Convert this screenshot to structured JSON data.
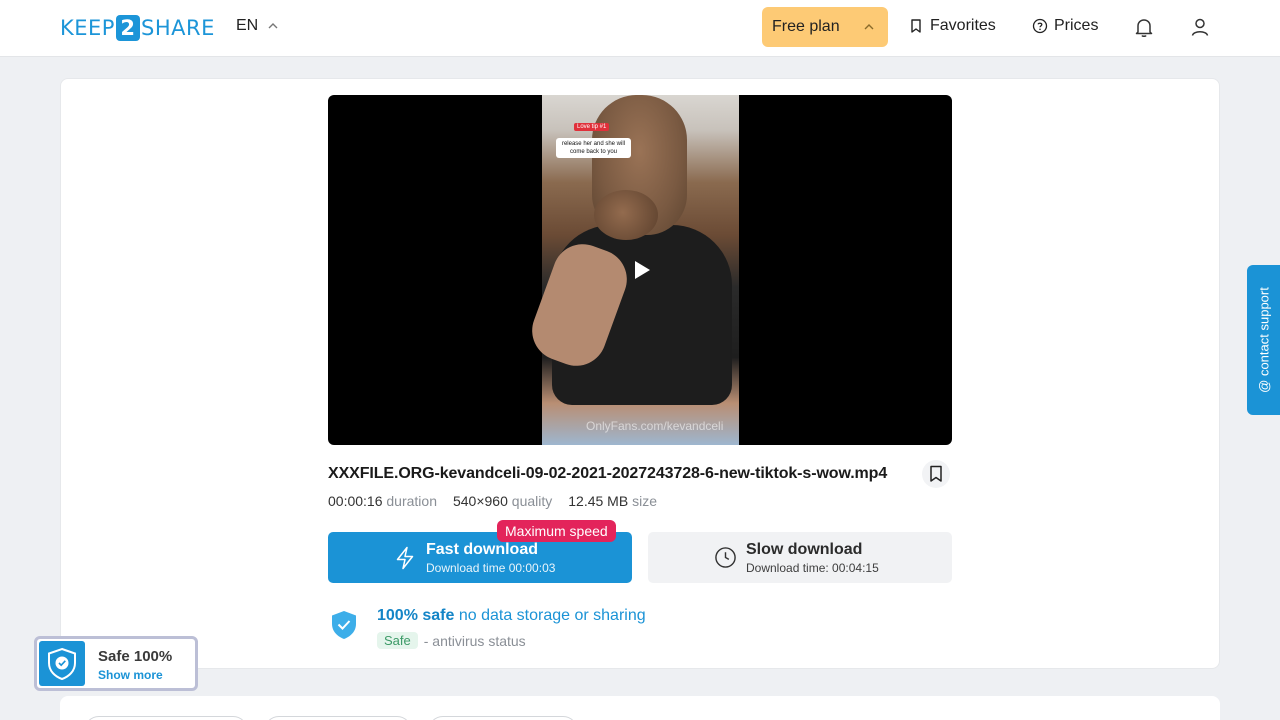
{
  "header": {
    "logo_left": "KEEP",
    "logo_num": "2",
    "logo_right": "SHARE",
    "lang": "EN",
    "plan_label": "Free plan",
    "favorites": "Favorites",
    "prices": "Prices"
  },
  "video": {
    "caption_red": "Love tip #1",
    "caption_white": "release her and she will come back to you",
    "watermark": "OnlyFans.com/kevandceli"
  },
  "file": {
    "name": "XXXFILE.ORG-kevandceli-09-02-2021-2027243728-6-new-tiktok-s-wow.mp4",
    "duration_value": "00:00:16",
    "duration_label": "duration",
    "quality_value": "540×960",
    "quality_label": "quality",
    "size_value": "12.45 MB",
    "size_label": "size"
  },
  "download": {
    "badge": "Maximum speed",
    "fast_title": "Fast download",
    "fast_sub": "Download time 00:00:03",
    "slow_title": "Slow download",
    "slow_sub": "Download time: 00:04:15"
  },
  "safety": {
    "strong": "100% safe",
    "rest": "no data storage or sharing",
    "chip": "Safe",
    "status": "- antivirus status"
  },
  "contact": "@ contact support",
  "widget": {
    "title": "Safe 100%",
    "link": "Show more"
  },
  "colors": {
    "brand_blue": "#1b93d6",
    "plan_yellow": "#fdca75",
    "badge_pink": "#e3245b"
  }
}
